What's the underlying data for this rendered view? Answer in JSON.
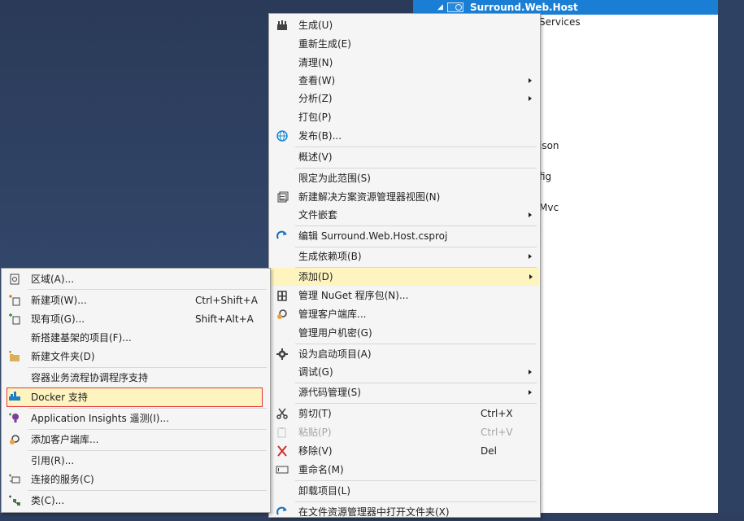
{
  "solution_explorer": {
    "selected_project": "Surround.Web.Host",
    "partial_items": [
      "Services",
      "json",
      "fig",
      "Mvc"
    ]
  },
  "context_menu": {
    "items": [
      {
        "label": "生成(U)",
        "icon": "build-icon"
      },
      {
        "label": "重新生成(E)"
      },
      {
        "label": "清理(N)"
      },
      {
        "label": "查看(W)",
        "submenu": true
      },
      {
        "label": "分析(Z)",
        "submenu": true
      },
      {
        "label": "打包(P)"
      },
      {
        "label": "发布(B)...",
        "icon": "publish-globe-icon"
      },
      {
        "label": "概述(V)"
      },
      {
        "label": "限定为此范围(S)"
      },
      {
        "label": "新建解决方案资源管理器视图(N)",
        "icon": "new-view-icon"
      },
      {
        "label": "文件嵌套",
        "submenu": true
      },
      {
        "label": "编辑 Surround.Web.Host.csproj",
        "icon": "edit-refresh-icon"
      },
      {
        "label": "生成依赖项(B)",
        "submenu": true
      },
      {
        "label": "添加(D)",
        "submenu": true,
        "highlighted": true
      },
      {
        "label": "管理 NuGet 程序包(N)...",
        "icon": "nuget-icon"
      },
      {
        "label": "管理客户端库...",
        "icon": "client-library-icon"
      },
      {
        "label": "管理用户机密(G)"
      },
      {
        "label": "设为启动项目(A)",
        "icon": "gear-icon"
      },
      {
        "label": "调试(G)",
        "submenu": true
      },
      {
        "label": "源代码管理(S)",
        "submenu": true
      },
      {
        "label": "剪切(T)",
        "shortcut": "Ctrl+X",
        "icon": "scissors-icon"
      },
      {
        "label": "粘贴(P)",
        "shortcut": "Ctrl+V",
        "icon": "paste-icon",
        "disabled": true
      },
      {
        "label": "移除(V)",
        "shortcut": "Del",
        "icon": "remove-x-icon"
      },
      {
        "label": "重命名(M)",
        "icon": "rename-icon"
      },
      {
        "label": "卸载项目(L)"
      },
      {
        "label": "在文件资源管理器中打开文件夹(X)",
        "icon": "open-folder-icon"
      }
    ]
  },
  "add_submenu": {
    "items": [
      {
        "label": "区域(A)...",
        "icon": "area-icon"
      },
      {
        "label": "新建项(W)...",
        "shortcut": "Ctrl+Shift+A",
        "icon": "new-item-icon"
      },
      {
        "label": "现有项(G)...",
        "shortcut": "Shift+Alt+A",
        "icon": "existing-item-icon"
      },
      {
        "label": "新搭建基架的项目(F)..."
      },
      {
        "label": "新建文件夹(D)",
        "icon": "new-folder-icon"
      },
      {
        "label": "容器业务流程协调程序支持"
      },
      {
        "label": "Docker 支持",
        "icon": "docker-icon",
        "highlighted": true
      },
      {
        "label": "Application Insights 遥测(I)...",
        "icon": "app-insights-icon"
      },
      {
        "label": "添加客户端库...",
        "icon": "client-library-icon"
      },
      {
        "label": "引用(R)..."
      },
      {
        "label": "连接的服务(C)",
        "icon": "connected-services-icon"
      },
      {
        "label": "类(C)...",
        "icon": "class-icon"
      }
    ]
  },
  "colors": {
    "menu_bg": "#f5f5f5",
    "highlight": "#fdf4bf",
    "highlight_border": "#e5323a",
    "selection": "#1a7fd4",
    "background": "#2d3e5e"
  }
}
